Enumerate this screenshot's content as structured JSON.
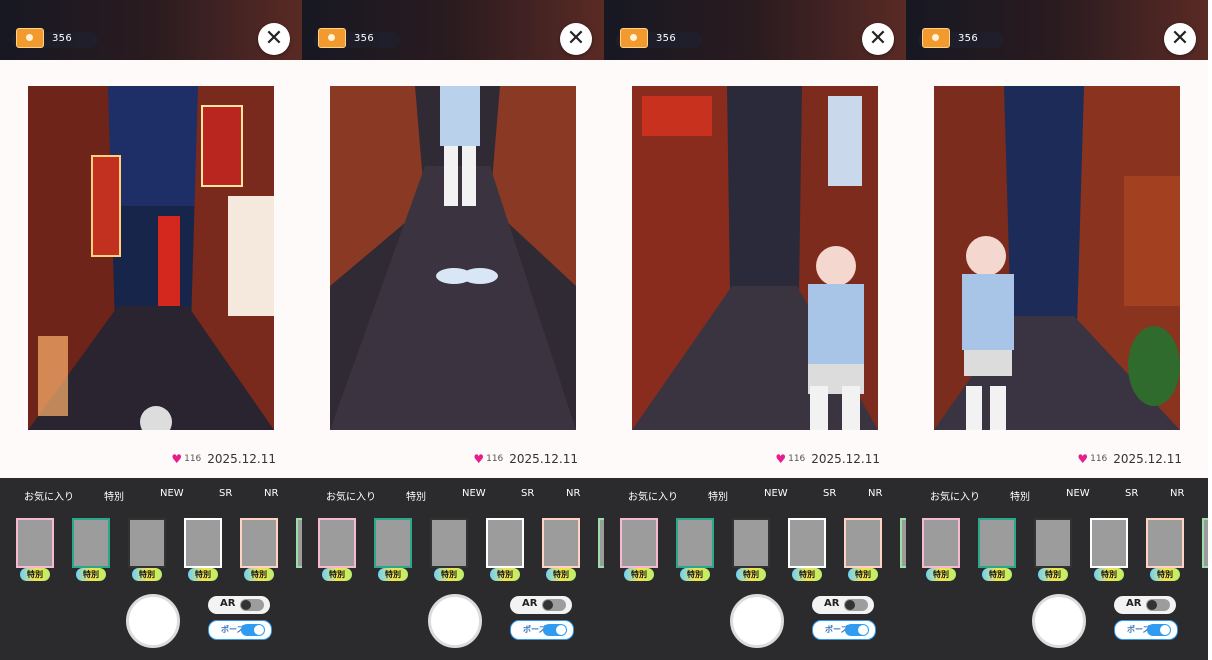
{
  "screens": [
    {
      "ticket_count": "356",
      "likes": "116",
      "date": "2025.12.11"
    },
    {
      "ticket_count": "356",
      "likes": "116",
      "date": "2025.12.11"
    },
    {
      "ticket_count": "356",
      "likes": "116",
      "date": "2025.12.11"
    },
    {
      "ticket_count": "356",
      "likes": "116",
      "date": "2025.12.11"
    }
  ],
  "tabs": [
    "お気に入り",
    "特別",
    "NEW",
    "SR",
    "NR"
  ],
  "frame_badge": "特別",
  "toggles": {
    "ar_label": "AR",
    "pose_label": "ポーズ"
  },
  "icons": {
    "close": "close-icon",
    "ticket": "ticket-icon",
    "heart": "heart-icon"
  },
  "colors": {
    "accent": "#2f9cf2",
    "heart": "#e61d8c",
    "panel": "#2b2b2d"
  }
}
